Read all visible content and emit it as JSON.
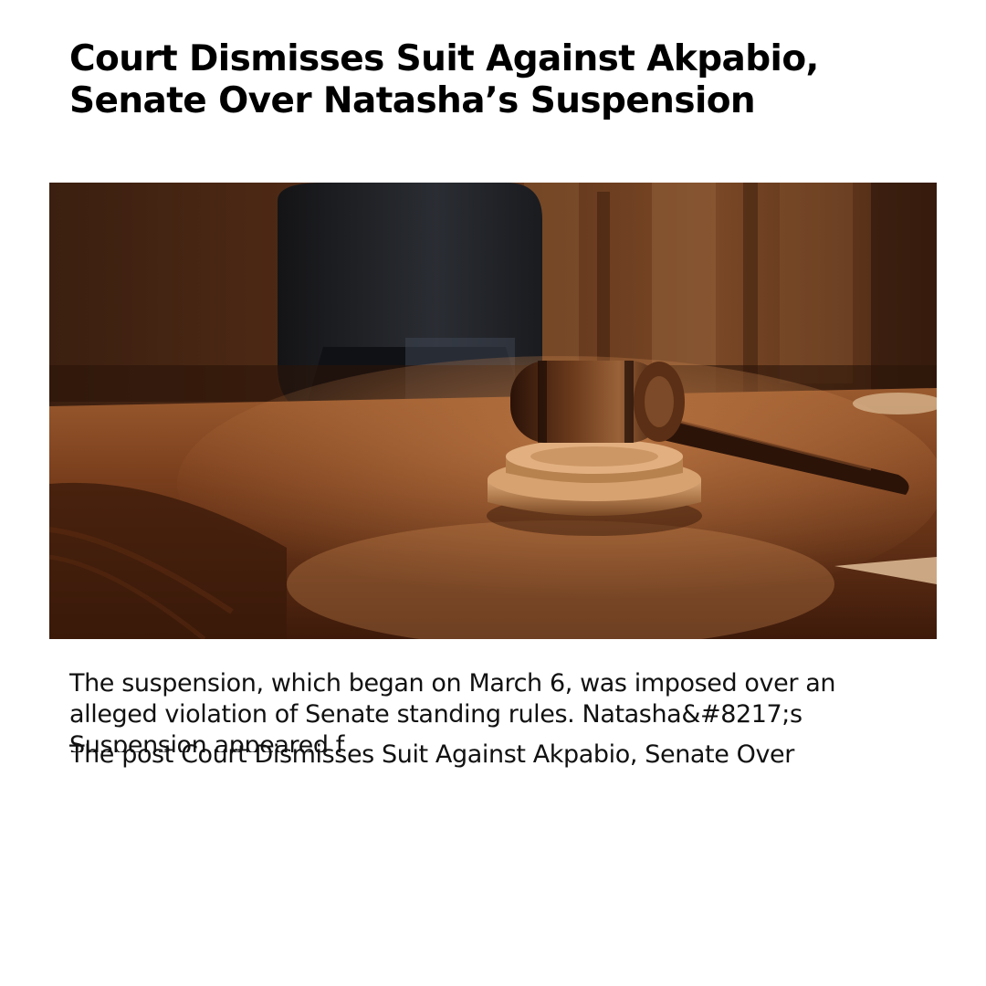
{
  "article": {
    "headline_line1": "Court Dismisses Suit Against Akpabio,",
    "headline_line2": "Senate Over Natasha’s Suspension",
    "hero_image": {
      "subject": "judge's gavel on wooden courtroom desk",
      "icon": "gavel-photo"
    },
    "excerpt": "The suspension, which began on March 6, was imposed over an alleged violation of Senate standing rules. Natasha&#8217;s Suspension appeared f",
    "post_line": "The post Court Dismisses Suit Against Akpabio, Senate Over"
  },
  "colors": {
    "background": "#ffffff",
    "text": "#000000",
    "wood_dark": "#3a1d0c",
    "wood_mid": "#8a4a22",
    "wood_light": "#c27a45"
  }
}
